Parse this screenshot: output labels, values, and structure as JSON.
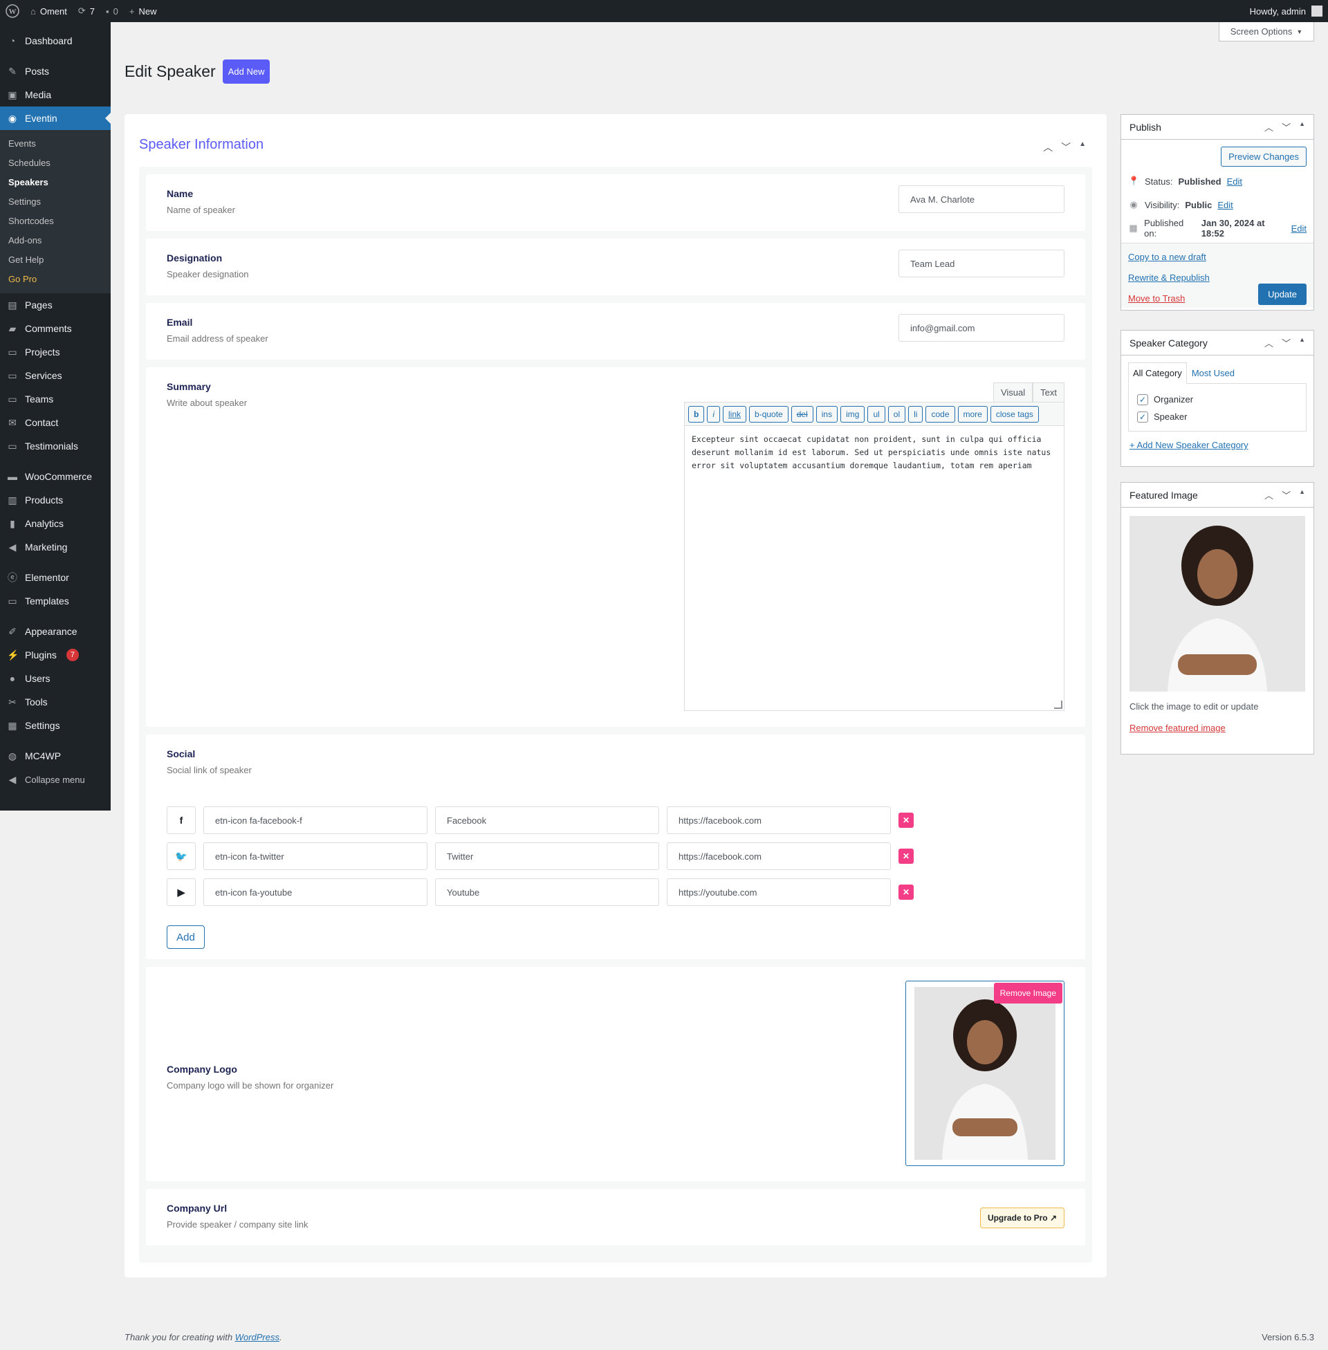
{
  "admin_bar": {
    "site_name": "Oment",
    "updates_count": "7",
    "comments_count": "0",
    "new_label": "New",
    "howdy": "Howdy, admin"
  },
  "sidebar": {
    "items": [
      {
        "label": "Dashboard",
        "icon": "dashboard-icon"
      },
      {
        "label": "Posts",
        "icon": "pin-icon"
      },
      {
        "label": "Media",
        "icon": "media-icon"
      },
      {
        "label": "Eventin",
        "icon": "eventin-icon"
      },
      {
        "label": "Pages",
        "icon": "page-icon"
      },
      {
        "label": "Comments",
        "icon": "comment-icon"
      },
      {
        "label": "Projects",
        "icon": "folder-icon"
      },
      {
        "label": "Services",
        "icon": "folder-icon"
      },
      {
        "label": "Teams",
        "icon": "folder-icon"
      },
      {
        "label": "Contact",
        "icon": "mail-icon"
      },
      {
        "label": "Testimonials",
        "icon": "folder-icon"
      },
      {
        "label": "WooCommerce",
        "icon": "woo-icon"
      },
      {
        "label": "Products",
        "icon": "archive-icon"
      },
      {
        "label": "Analytics",
        "icon": "chart-icon"
      },
      {
        "label": "Marketing",
        "icon": "megaphone-icon"
      },
      {
        "label": "Elementor",
        "icon": "elementor-icon"
      },
      {
        "label": "Templates",
        "icon": "folder-icon"
      },
      {
        "label": "Appearance",
        "icon": "brush-icon"
      },
      {
        "label": "Plugins",
        "icon": "plugin-icon",
        "badge": "7"
      },
      {
        "label": "Users",
        "icon": "user-icon"
      },
      {
        "label": "Tools",
        "icon": "wrench-icon"
      },
      {
        "label": "Settings",
        "icon": "settings-icon"
      },
      {
        "label": "MC4WP",
        "icon": "mc4wp-icon"
      },
      {
        "label": "Collapse menu",
        "icon": "collapse-icon"
      }
    ],
    "submenu": [
      "Events",
      "Schedules",
      "Speakers",
      "Settings",
      "Shortcodes",
      "Add-ons",
      "Get Help",
      "Go Pro"
    ]
  },
  "screen_options": "Screen Options",
  "page": {
    "title": "Edit Speaker",
    "add_new": "Add New"
  },
  "speaker_box": {
    "title": "Speaker Information",
    "name": {
      "label": "Name",
      "desc": "Name of speaker",
      "value": "Ava M. Charlote"
    },
    "designation": {
      "label": "Designation",
      "desc": "Speaker designation",
      "value": "Team Lead"
    },
    "email": {
      "label": "Email",
      "desc": "Email address of speaker",
      "value": "info@gmail.com"
    },
    "summary": {
      "label": "Summary",
      "desc": "Write about speaker",
      "tab_visual": "Visual",
      "tab_text": "Text",
      "quicktags": [
        "b",
        "i",
        "link",
        "b-quote",
        "del",
        "ins",
        "img",
        "ul",
        "ol",
        "li",
        "code",
        "more",
        "close tags"
      ],
      "content": "Excepteur sint occaecat cupidatat non proident, sunt in culpa qui officia deserunt mollanim id est laborum. Sed ut perspiciatis unde omnis iste natus error sit voluptatem accusantium doremque laudantium, totam rem aperiam"
    },
    "social": {
      "label": "Social",
      "desc": "Social link of speaker",
      "rows": [
        {
          "icon_glyph": "f",
          "icon_class": "etn-icon fa-facebook-f",
          "title": "Facebook",
          "url": "https://facebook.com"
        },
        {
          "icon_glyph": "🐦",
          "icon_class": "etn-icon fa-twitter",
          "title": "Twitter",
          "url": "https://facebook.com"
        },
        {
          "icon_glyph": "▶",
          "icon_class": "etn-icon fa-youtube",
          "title": "Youtube",
          "url": "https://youtube.com"
        }
      ],
      "add_label": "Add",
      "remove_glyph": "✕"
    },
    "company_logo": {
      "label": "Company Logo",
      "desc": "Company logo will be shown for organizer",
      "remove_label": "Remove Image"
    },
    "company_url": {
      "label": "Company Url",
      "desc": "Provide speaker / company site link",
      "upgrade_label": "Upgrade to Pro ↗"
    }
  },
  "publish": {
    "title": "Publish",
    "preview": "Preview Changes",
    "status_label": "Status:",
    "status_value": "Published",
    "visibility_label": "Visibility:",
    "visibility_value": "Public",
    "published_label": "Published on:",
    "published_value": "Jan 30, 2024 at 18:52",
    "edit": "Edit",
    "copy_draft": "Copy to a new draft",
    "rewrite": "Rewrite & Republish",
    "trash": "Move to Trash",
    "update": "Update"
  },
  "speaker_category": {
    "title": "Speaker Category",
    "tab_all": "All Category",
    "tab_most_used": "Most Used",
    "items": [
      "Organizer",
      "Speaker"
    ],
    "add_new": "+ Add New Speaker Category"
  },
  "featured_image": {
    "title": "Featured Image",
    "hint": "Click the image to edit or update",
    "remove": "Remove featured image"
  },
  "footer": {
    "thanks_prefix": "Thank you for creating with ",
    "wordpress": "WordPress",
    "thanks_suffix": ".",
    "version": "Version 6.5.3"
  },
  "colors": {
    "accent": "#5b5bf7",
    "wp_blue": "#2271b1",
    "pink": "#f33d87",
    "admin_dark": "#1d2327"
  }
}
